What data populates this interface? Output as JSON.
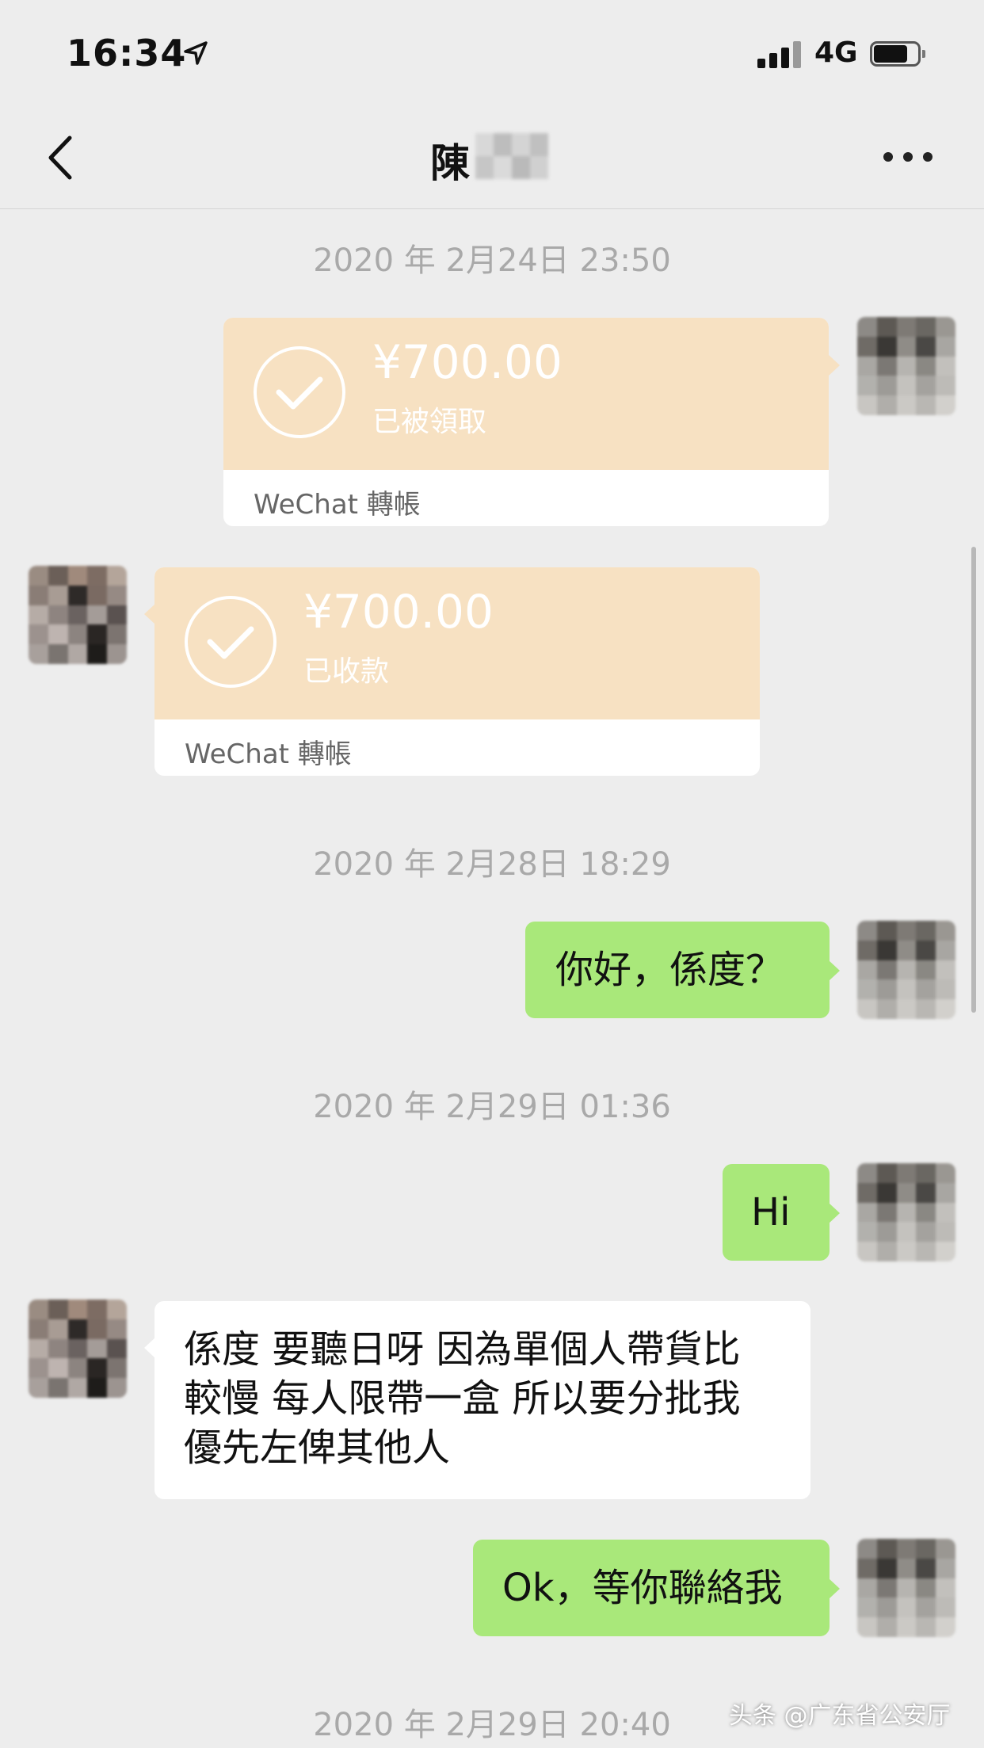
{
  "status_bar": {
    "time": "16:34",
    "network": "4G"
  },
  "header": {
    "title": "陳"
  },
  "timestamps": {
    "t1": "2020 年 2月24日 23:50",
    "t2": "2020 年 2月28日 18:29",
    "t3": "2020 年 2月29日 01:36",
    "t4": "2020 年 2月29日 20:40"
  },
  "messages": {
    "transfer_sent": {
      "amount": "¥700.00",
      "status": "已被領取",
      "label": "WeChat 轉帳"
    },
    "transfer_received": {
      "amount": "¥700.00",
      "status": "已收款",
      "label": "WeChat 轉帳"
    },
    "msg1": "你好，係度？",
    "msg2": "Hi",
    "msg3_line1": "係度 要聽日呀 因為單個人帶貨比",
    "msg3_line2": "較慢 每人限帶一盒 所以要分批我",
    "msg3_line3": "優先左俾其他人",
    "msg4": "Ok，等你聯絡我"
  },
  "watermark": "头条 @广东省公安厅",
  "colors": {
    "background": "#ededed",
    "my_bubble": "#a9e87a",
    "their_bubble": "#ffffff",
    "transfer_card": "#f7e1c2",
    "timestamp": "#a9a9a9"
  },
  "icons": [
    "location-arrow-icon",
    "signal-icon",
    "battery-icon",
    "back-icon",
    "more-icon",
    "check-icon"
  ]
}
